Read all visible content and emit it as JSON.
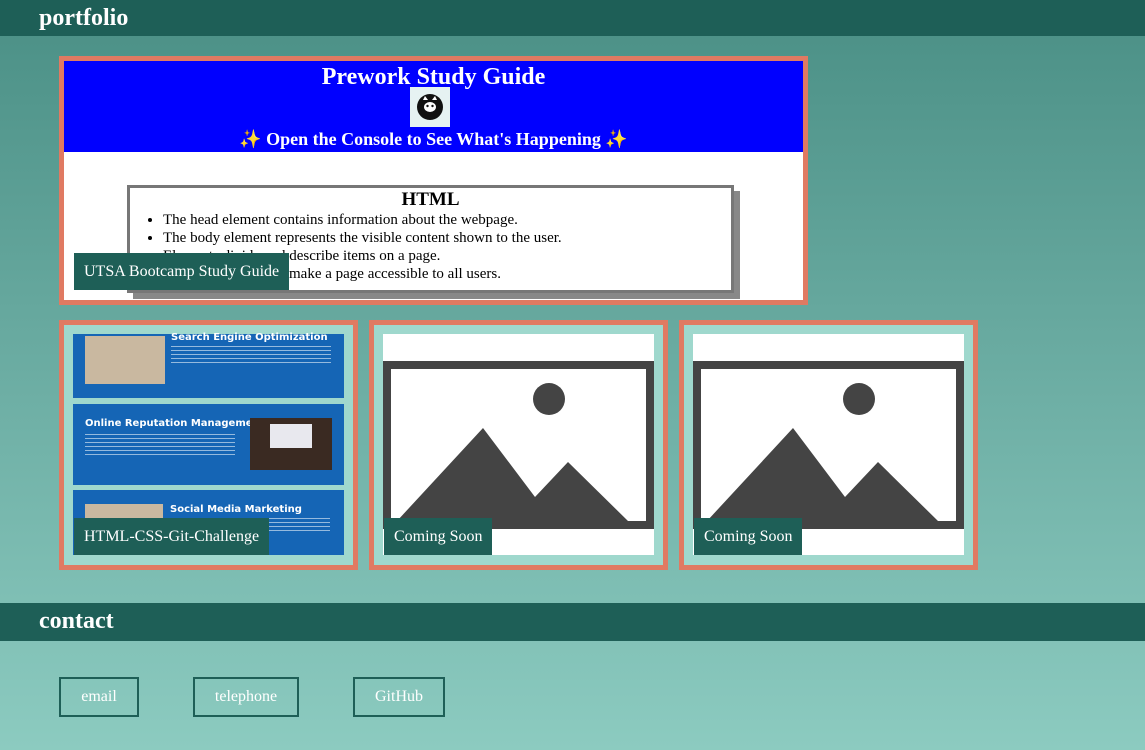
{
  "sections": {
    "portfolio_title": "portfolio",
    "contact_title": "contact"
  },
  "featured": {
    "banner_title": "Prework Study Guide",
    "banner_subtitle": "✨ Open the Console to See What's Happening ✨",
    "notes_heading": "HTML",
    "notes_items": [
      "The head element contains information about the webpage.",
      "The body element represents the visible content shown to the user.",
      "Elements divide and describe items on a page.",
      "make a page accessible to all users."
    ],
    "label": "UTSA Bootcamp Study Guide"
  },
  "cards": [
    {
      "label": "HTML-CSS-Git-Challenge",
      "preview_headings": [
        "Search Engine Optimization",
        "Online Reputation Management",
        "Social Media Marketing"
      ]
    },
    {
      "label": "Coming Soon"
    },
    {
      "label": "Coming Soon"
    }
  ],
  "contact": {
    "email": "email",
    "telephone": "telephone",
    "github": "GitHub"
  },
  "colors": {
    "header_bg": "#1e5f57",
    "card_border": "#e07a62",
    "banner_blue": "#0000ff"
  }
}
